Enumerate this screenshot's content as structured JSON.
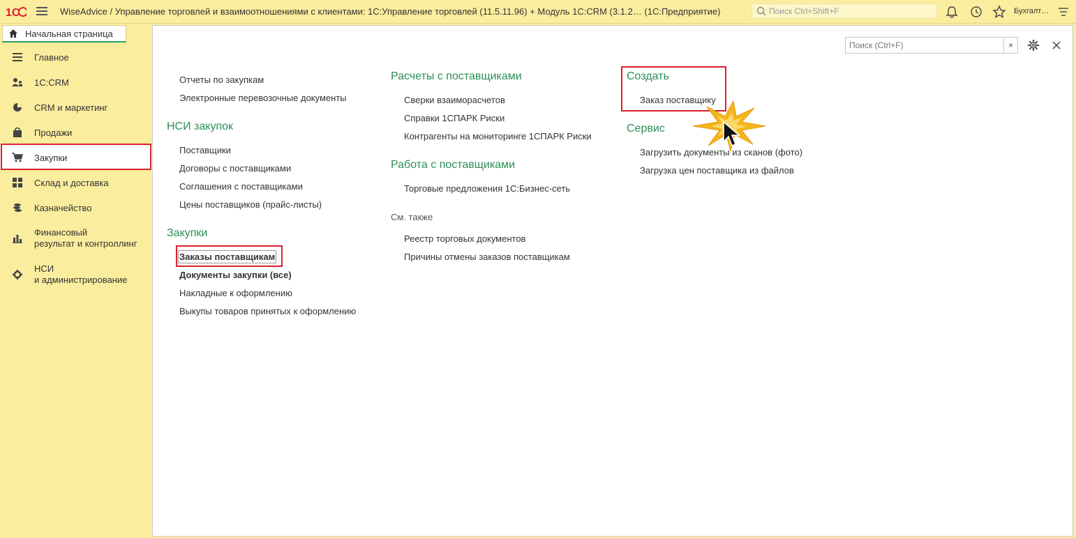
{
  "titlebar": {
    "title": "WiseAdvice / Управление торговлей и взаимоотношениями с клиентами: 1С:Управление торговлей (11.5.11.96) + Модуль 1С:CRM (3.1.2…  (1С:Предприятие)",
    "search_placeholder": "Поиск Ctrl+Shift+F",
    "user": "Бухгалт…"
  },
  "home_tab": {
    "label": "Начальная страница"
  },
  "sidebar": {
    "items": [
      {
        "label": "Главное",
        "icon": "list-icon"
      },
      {
        "label": "1С:CRM",
        "icon": "users-icon"
      },
      {
        "label": "CRM и маркетинг",
        "icon": "pie-chart-icon"
      },
      {
        "label": "Продажи",
        "icon": "bag-icon"
      },
      {
        "label": "Закупки",
        "icon": "cart-icon",
        "active": true
      },
      {
        "label": "Склад и доставка",
        "icon": "grid-icon"
      },
      {
        "label": "Казначейство",
        "icon": "coins-icon"
      },
      {
        "label": "Финансовый\nрезультат и контроллинг",
        "line1": "Финансовый",
        "line2": "результат и контроллинг",
        "icon": "bar-chart-icon"
      },
      {
        "label": "НСИ\nи администрирование",
        "line1": "НСИ",
        "line2": "и администрирование",
        "icon": "gear-icon"
      }
    ]
  },
  "panel": {
    "search_placeholder": "Поиск (Ctrl+F)",
    "col1": {
      "top_links": [
        "Отчеты по закупкам",
        "Электронные перевозочные документы"
      ],
      "nsi_title": "НСИ закупок",
      "nsi_links": [
        "Поставщики",
        "Договоры с поставщиками",
        "Соглашения с поставщиками",
        "Цены поставщиков (прайс-листы)"
      ],
      "purchases_title": "Закупки",
      "purchases_links": [
        "Заказы поставщикам",
        "Документы закупки (все)",
        "Накладные к оформлению",
        "Выкупы товаров принятых к оформлению"
      ]
    },
    "col2": {
      "settlements_title": "Расчеты с поставщиками",
      "settlements_links": [
        "Сверки взаиморасчетов",
        "Справки 1СПАРК Риски",
        "Контрагенты на мониторинге 1СПАРК Риски"
      ],
      "work_title": "Работа с поставщиками",
      "work_links": [
        "Торговые предложения 1С:Бизнес-сеть"
      ],
      "see_also": "См. также",
      "see_also_links": [
        "Реестр торговых документов",
        "Причины отмены заказов поставщикам"
      ]
    },
    "col3": {
      "create_title": "Создать",
      "create_links": [
        "Заказ поставщику"
      ],
      "service_title": "Сервис",
      "service_links": [
        "Загрузить документы из сканов (фото)",
        "Загрузка цен поставщика из файлов"
      ]
    }
  },
  "colors": {
    "accent_green": "#2a8f54",
    "sidebar_bg": "#fbed9e",
    "highlight_red": "#d9202c"
  }
}
